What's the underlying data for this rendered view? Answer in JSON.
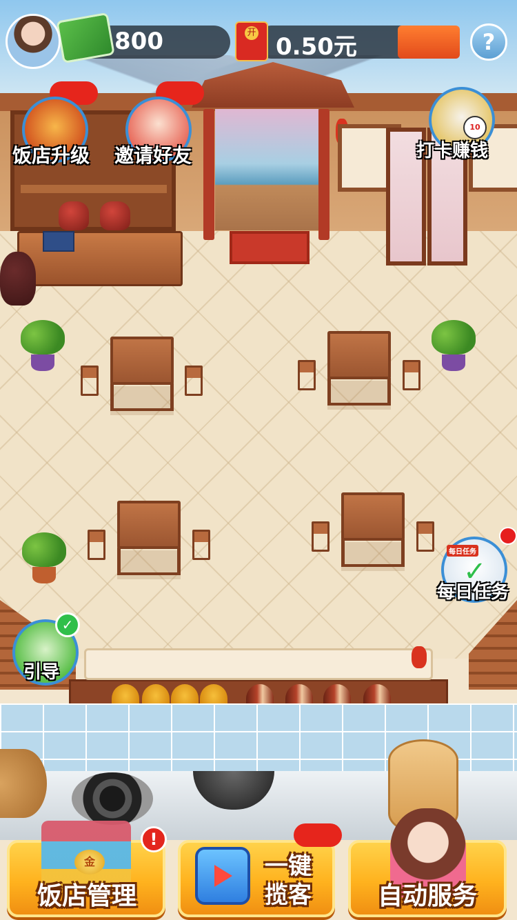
{
  "hud": {
    "cash_amount": "800",
    "redpacket_seal": "开",
    "redpacket_amount": "0.50元",
    "help_symbol": "?"
  },
  "features": {
    "restaurant_upgrade": "饭店升级",
    "invite_friends": "邀请好友",
    "checkin_earn": "打卡赚钱",
    "daily_tasks": "每日任务",
    "daily_tasks_icon_text": "每日任务",
    "checkin_clock_number": "10",
    "guide": "引导",
    "guide_check": "✓"
  },
  "bottom": {
    "restaurant_management": "饭店管理",
    "management_alert": "!",
    "one_click_line1": "一键",
    "one_click_line2": "揽客",
    "auto_service": "自动服务",
    "shop_sign": "金"
  },
  "colors": {
    "badge_red": "#e6251c",
    "button_gold": "#ffb21e",
    "icon_ring_blue": "#3b8fd6"
  }
}
